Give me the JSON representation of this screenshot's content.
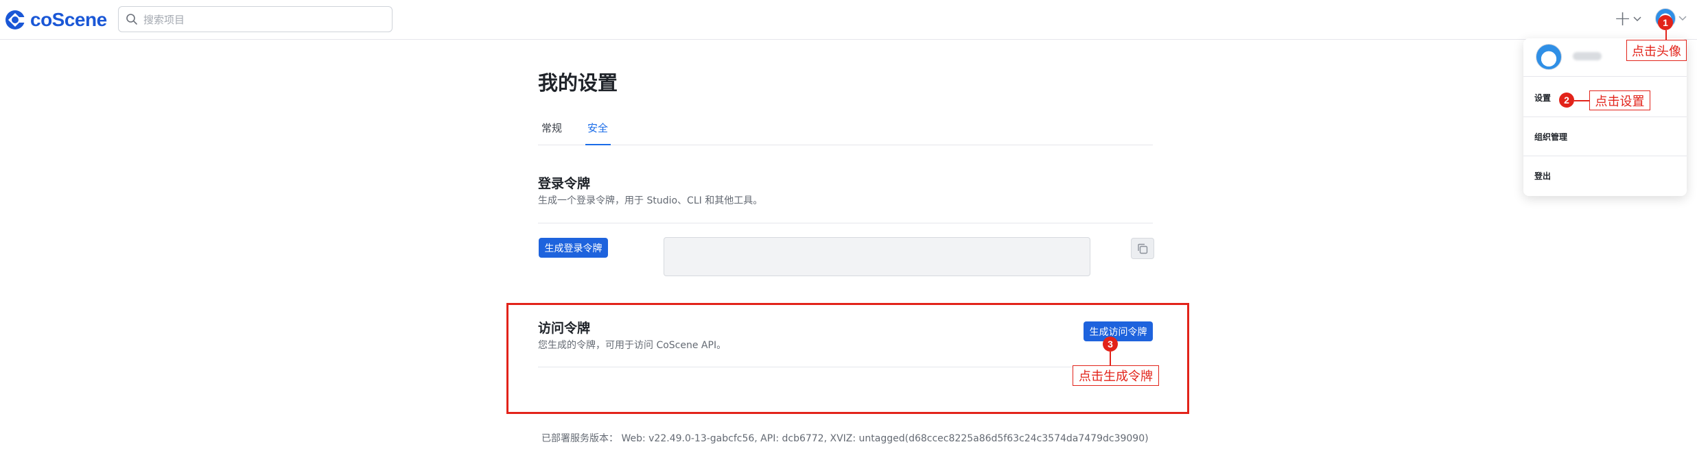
{
  "app": {
    "name": "coScene",
    "brand_color": "#1a57d6",
    "accent_color": "#1e63dd",
    "annotation_color": "#e2231a"
  },
  "search": {
    "placeholder": "搜索项目"
  },
  "header": {
    "plus_icon": "plus-icon",
    "avatar_icon": "doraemon-avatar"
  },
  "page": {
    "title": "我的设置",
    "tabs": [
      {
        "label": "常规",
        "active": false
      },
      {
        "label": "安全",
        "active": true
      }
    ]
  },
  "login_token": {
    "title": "登录令牌",
    "desc": "生成一个登录令牌，用于 Studio、CLI 和其他工具。",
    "button": "生成登录令牌",
    "value": ""
  },
  "access_token": {
    "title": "访问令牌",
    "desc": "您生成的令牌，可用于访问 CoScene API。",
    "button": "生成访问令牌"
  },
  "version": {
    "text": "已部署服务版本：  Web: v22.49.0-13-gabcfc56, API: dcb6772, XVIZ: untagged(d68ccec8225a86d5f63c24c3574da7479dc39090)"
  },
  "user_menu": {
    "items": [
      {
        "label": "设置"
      },
      {
        "label": "组织管理"
      },
      {
        "label": "登出"
      }
    ]
  },
  "annotations": [
    {
      "number": "1",
      "text": "点击头像"
    },
    {
      "number": "2",
      "text": "点击设置"
    },
    {
      "number": "3",
      "text": "点击生成令牌"
    }
  ]
}
